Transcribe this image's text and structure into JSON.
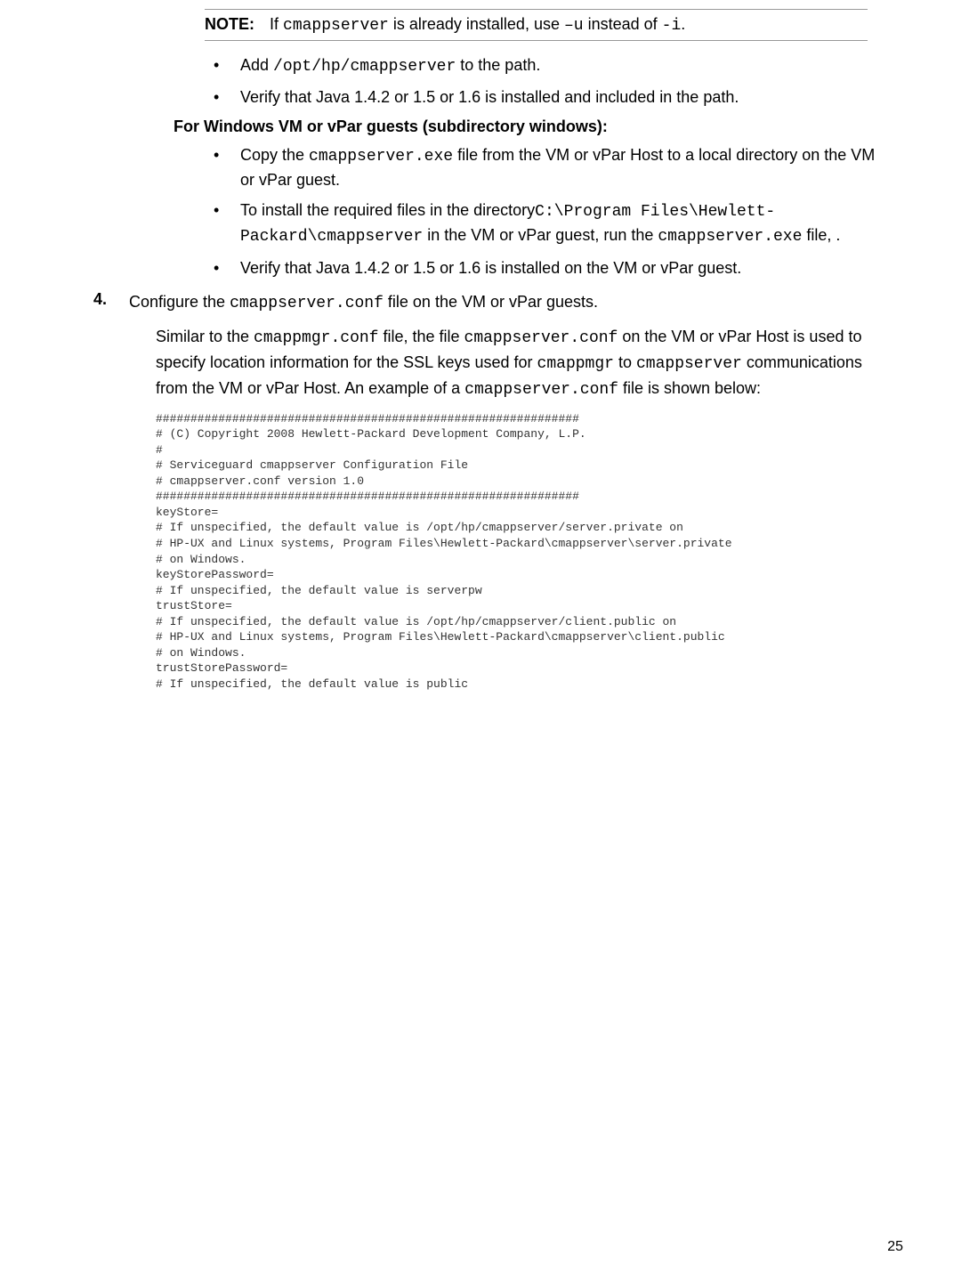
{
  "note": {
    "label": "NOTE:",
    "text_before_code1": "If ",
    "code1": "cmappserver",
    "text_mid1": " is already installed, use ",
    "code2": "–u",
    "text_mid2": " instead of ",
    "code3": "-i",
    "text_after": "."
  },
  "bullets1": [
    {
      "parts": [
        {
          "t": "Add ",
          "mono": false
        },
        {
          "t": "/opt/hp/cmappserver",
          "mono": true
        },
        {
          "t": " to the path.",
          "mono": false
        }
      ]
    },
    {
      "parts": [
        {
          "t": "Verify that Java 1.4.2 or 1.5 or 1.6 is installed and included in the path.",
          "mono": false
        }
      ]
    }
  ],
  "subhead": "For Windows VM or vPar guests (subdirectory windows):",
  "bullets2": [
    {
      "parts": [
        {
          "t": "Copy the ",
          "mono": false
        },
        {
          "t": "cmappserver.exe",
          "mono": true
        },
        {
          "t": " file from the VM or vPar Host to a local directory on the VM or vPar guest.",
          "mono": false
        }
      ]
    },
    {
      "parts": [
        {
          "t": "To install the required files in the directory",
          "mono": false
        },
        {
          "t": "C:\\Program Files\\Hewlett-Packard\\cmappserver",
          "mono": true
        },
        {
          "t": " in the VM or vPar guest, run the ",
          "mono": false
        },
        {
          "t": "cmappserver.exe",
          "mono": true
        },
        {
          "t": " file, .",
          "mono": false
        }
      ]
    },
    {
      "parts": [
        {
          "t": "Verify that Java 1.4.2 or 1.5 or 1.6 is installed on the VM or vPar guest.",
          "mono": false
        }
      ]
    }
  ],
  "step4": {
    "num": "4.",
    "parts": [
      {
        "t": "Configure the ",
        "mono": false
      },
      {
        "t": "cmappserver.conf",
        "mono": true
      },
      {
        "t": " file on the VM or vPar guests.",
        "mono": false
      }
    ]
  },
  "para": {
    "parts": [
      {
        "t": "Similar to the ",
        "mono": false
      },
      {
        "t": "cmappmgr.conf",
        "mono": true
      },
      {
        "t": " file, the file ",
        "mono": false
      },
      {
        "t": "cmappserver.conf",
        "mono": true
      },
      {
        "t": " on the VM or vPar Host is used to specify location information for the SSL keys used for ",
        "mono": false
      },
      {
        "t": "cmappmgr",
        "mono": true
      },
      {
        "t": " to ",
        "mono": false
      },
      {
        "t": "cmappserver",
        "mono": true
      },
      {
        "t": " communications from the VM or vPar Host. An example of a ",
        "mono": false
      },
      {
        "t": "cmappserver.conf",
        "mono": true
      },
      {
        "t": " file is shown below:",
        "mono": false
      }
    ]
  },
  "code": "#############################################################\n# (C) Copyright 2008 Hewlett-Packard Development Company, L.P.\n#\n# Serviceguard cmappserver Configuration File\n# cmappserver.conf version 1.0\n#############################################################\nkeyStore=\n# If unspecified, the default value is /opt/hp/cmappserver/server.private on\n# HP-UX and Linux systems, Program Files\\Hewlett-Packard\\cmappserver\\server.private\n# on Windows.\nkeyStorePassword=\n# If unspecified, the default value is serverpw\ntrustStore=\n# If unspecified, the default value is /opt/hp/cmappserver/client.public on\n# HP-UX and Linux systems, Program Files\\Hewlett-Packard\\cmappserver\\client.public\n# on Windows.\ntrustStorePassword=\n# If unspecified, the default value is public",
  "pagenum": "25"
}
